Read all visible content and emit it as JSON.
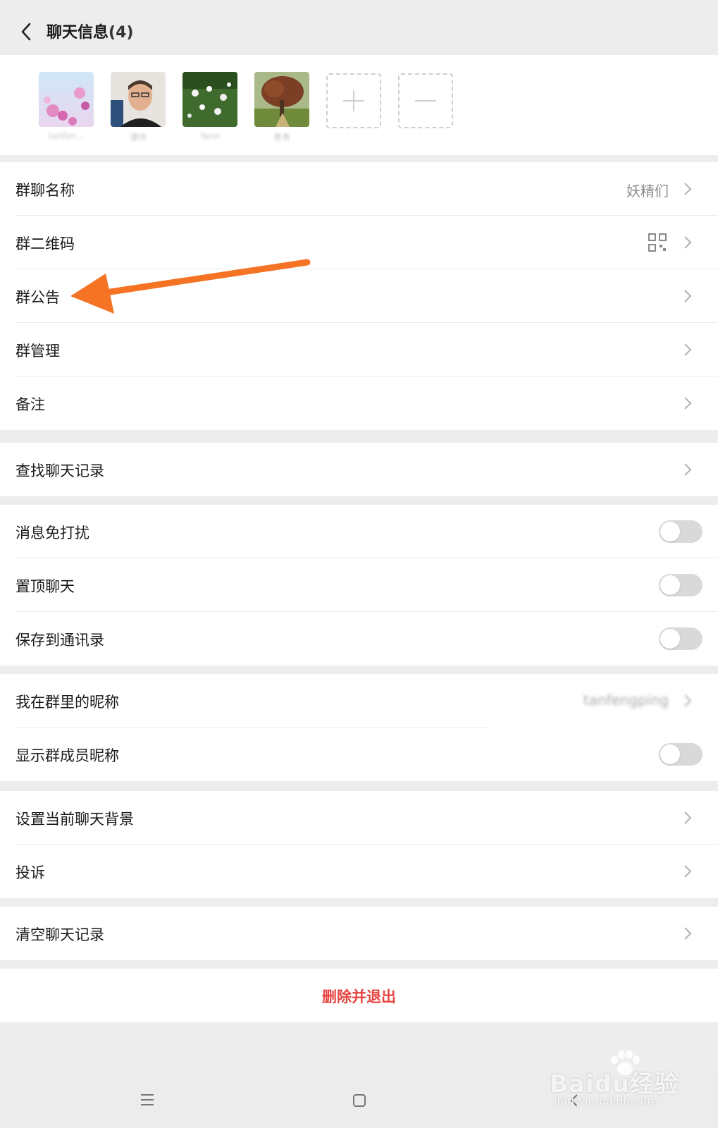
{
  "header": {
    "title": "聊天信息",
    "member_count": "(4)"
  },
  "members": [
    {
      "name": "tanfen...",
      "avatar": "pink-flowers-photo"
    },
    {
      "name": "谭伟",
      "avatar": "man-portrait-photo"
    },
    {
      "name": "Yann",
      "avatar": "white-flowers-photo"
    },
    {
      "name": "青青",
      "avatar": "tree-photo"
    }
  ],
  "member_actions": {
    "add": "plus-icon",
    "remove": "minus-icon"
  },
  "settings": {
    "group_name": {
      "label": "群聊名称",
      "value": "妖精们"
    },
    "qr_code": {
      "label": "群二维码"
    },
    "announcement": {
      "label": "群公告"
    },
    "management": {
      "label": "群管理"
    },
    "remark": {
      "label": "备注"
    },
    "search_history": {
      "label": "查找聊天记录"
    },
    "mute": {
      "label": "消息免打扰",
      "on": false
    },
    "pin": {
      "label": "置顶聊天",
      "on": false
    },
    "save_contacts": {
      "label": "保存到通讯录",
      "on": false
    },
    "my_nickname": {
      "label": "我在群里的昵称",
      "value": "tanfengping"
    },
    "show_nicknames": {
      "label": "显示群成员昵称",
      "on": false
    },
    "background": {
      "label": "设置当前聊天背景"
    },
    "complaint": {
      "label": "投诉"
    },
    "clear_history": {
      "label": "清空聊天记录"
    }
  },
  "delete_exit": {
    "label": "删除并退出"
  },
  "navbar": {
    "menu": "menu-icon",
    "home": "home-icon",
    "back": "back-icon"
  },
  "watermark": {
    "brand": "Baidu经验",
    "url": "jingyan.baidu.com"
  },
  "colors": {
    "background": "#ededed",
    "danger": "#e64340",
    "arrow_annotation": "#f47324",
    "toggle_off": "#d9d9d9"
  }
}
